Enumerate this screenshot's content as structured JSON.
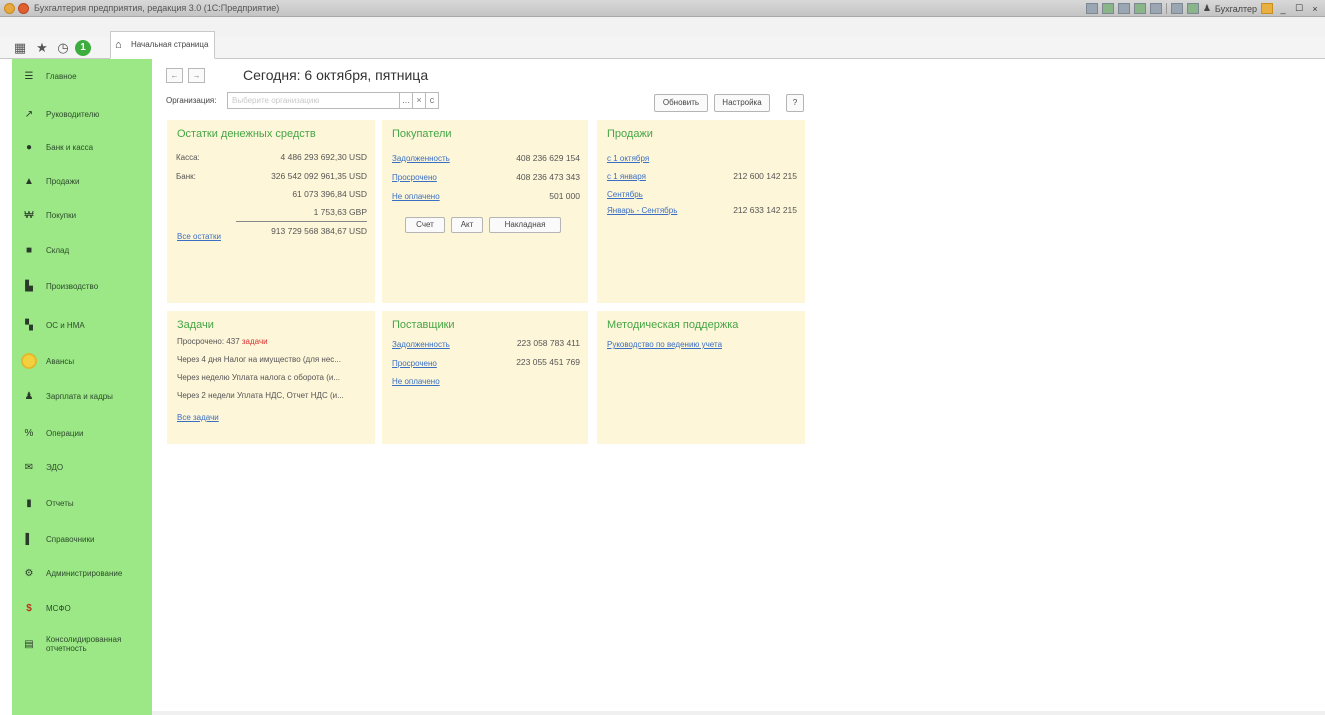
{
  "window": {
    "title": "Бухгалтерия предприятия, редакция 3.0 (1С:Предприятие)",
    "user": "Бухгалтер",
    "min": "_",
    "max": "☐",
    "close": "×"
  },
  "tabs": {
    "home_label": "Начальная страница"
  },
  "sidebar": {
    "items": [
      {
        "label": "Главное",
        "icon": "☰"
      },
      {
        "label": "Руководителю",
        "icon": "↗"
      },
      {
        "label": "Банк и касса",
        "icon": "●"
      },
      {
        "label": "Продажи",
        "icon": "▲"
      },
      {
        "label": "Покупки",
        "icon": "₩"
      },
      {
        "label": "Склад",
        "icon": "■"
      },
      {
        "label": "Производство",
        "icon": "▙"
      },
      {
        "label": "ОС и НМА",
        "icon": "▚"
      },
      {
        "label": "Авансы",
        "icon": "○"
      },
      {
        "label": "Зарплата и кадры",
        "icon": "♟"
      },
      {
        "label": "Операции",
        "icon": "%"
      },
      {
        "label": "ЭДО",
        "icon": "✉"
      },
      {
        "label": "Отчеты",
        "icon": "▮"
      },
      {
        "label": "Справочники",
        "icon": "▌"
      },
      {
        "label": "Администрирование",
        "icon": "⚙"
      },
      {
        "label": "МСФО",
        "icon": "$"
      },
      {
        "label": "Консолидированная отчетность",
        "icon": "▤"
      }
    ]
  },
  "header": {
    "back": "←",
    "forward": "→",
    "title": "Сегодня: 6 октября, пятница",
    "org_label": "Организация:",
    "org_placeholder": "Выберите организацию",
    "org_dropdown": "...",
    "org_clear": "×",
    "org_open": "с",
    "refresh_button": "Обновить",
    "settings_button": "Настройка",
    "help_button": "?"
  },
  "cash": {
    "title": "Остатки денежных средств",
    "kassa_label": "Касса:",
    "kassa_value": "4 486 293 692,30 USD",
    "bank_label": "Банк:",
    "bank_values": [
      "326 542 092 961,35 USD",
      "61 073 396,84 USD",
      "1 753,63 GBP"
    ],
    "all_link": "Все остатки",
    "total": "913 729 568 384,67 USD"
  },
  "buyers": {
    "title": "Покупатели",
    "debt_label": "Задолженность",
    "debt_value": "408 236 629 154",
    "overdue_label": "Просрочено",
    "overdue_value": "408 236 473 343",
    "unpaid_label": "Не оплачено",
    "unpaid_value": "501 000",
    "btn_invoice": "Счет",
    "btn_act": "Акт",
    "btn_waybill": "Накладная"
  },
  "sales": {
    "title": "Продажи",
    "link1": "с 1 октября",
    "link2": "с 1 января",
    "value2": "212 600 142 215",
    "link3": "Сентябрь",
    "link4": "Январь - Сентябрь",
    "value4": "212 633 142 215"
  },
  "tasks": {
    "title": "Задачи",
    "overdue_text": "Просрочено: 437",
    "overdue_suffix": "задачи",
    "items": [
      "Через 4 дня Налог на имущество (для нес...",
      "Через неделю Уплата налога с оборота (и...",
      "Через 2 недели Уплата НДС, Отчет НДС (и..."
    ],
    "all_link": "Все задачи"
  },
  "suppliers": {
    "title": "Поставщики",
    "debt_label": "Задолженность",
    "debt_value": "223 058 783 411",
    "overdue_label": "Просрочено",
    "overdue_value": "223 055 451 769",
    "unpaid_label": "Не оплачено"
  },
  "support": {
    "title": "Методическая поддержка",
    "link": "Руководство по ведению учета"
  },
  "colors": {
    "sidebar": "#9ce886",
    "panel": "#fdf6d9",
    "accent": "#46a546",
    "link": "#3a6fc4"
  }
}
